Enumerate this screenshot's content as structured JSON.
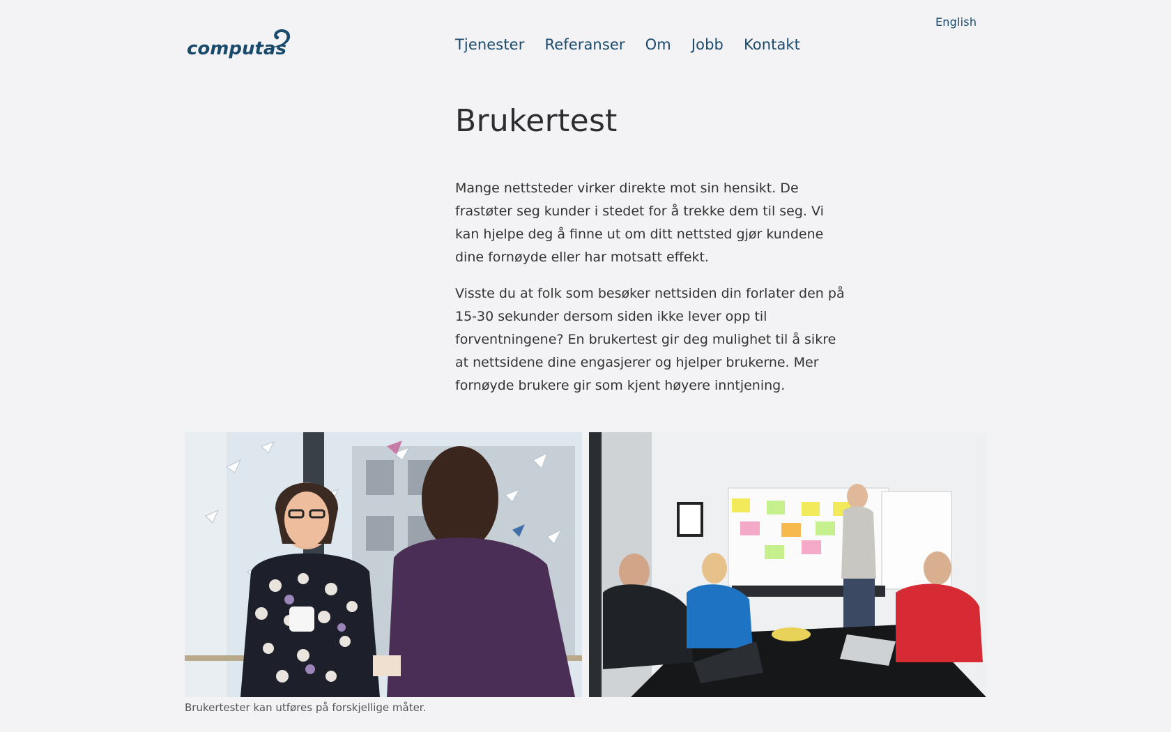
{
  "header": {
    "language_link": "English",
    "logo_text": "computas",
    "nav": [
      "Tjenester",
      "Referanser",
      "Om",
      "Jobb",
      "Kontakt"
    ]
  },
  "main": {
    "title": "Brukertest",
    "paragraphs": [
      "Mange nettsteder virker direkte mot sin hensikt. De frastøter seg kunder i stedet for å trekke dem til seg. Vi kan hjelpe deg å finne ut om ditt nettsted gjør kundene dine fornøyde eller har motsatt effekt.",
      "Visste du at folk som besøker nettsiden din forlater den på 15-30 sekunder dersom siden ikke lever opp til forventningene? En brukertest gir deg mulighet til å sikre at nettsidene dine engasjerer og hjelper brukerne. Mer fornøyde brukere gir som kjent høyere inntjening."
    ],
    "image_caption": "Brukertester kan utføres på forskjellige måter."
  },
  "colors": {
    "background": "#f3f3f5",
    "brand_blue": "#1a4a6b",
    "text": "#2b2b2b"
  }
}
